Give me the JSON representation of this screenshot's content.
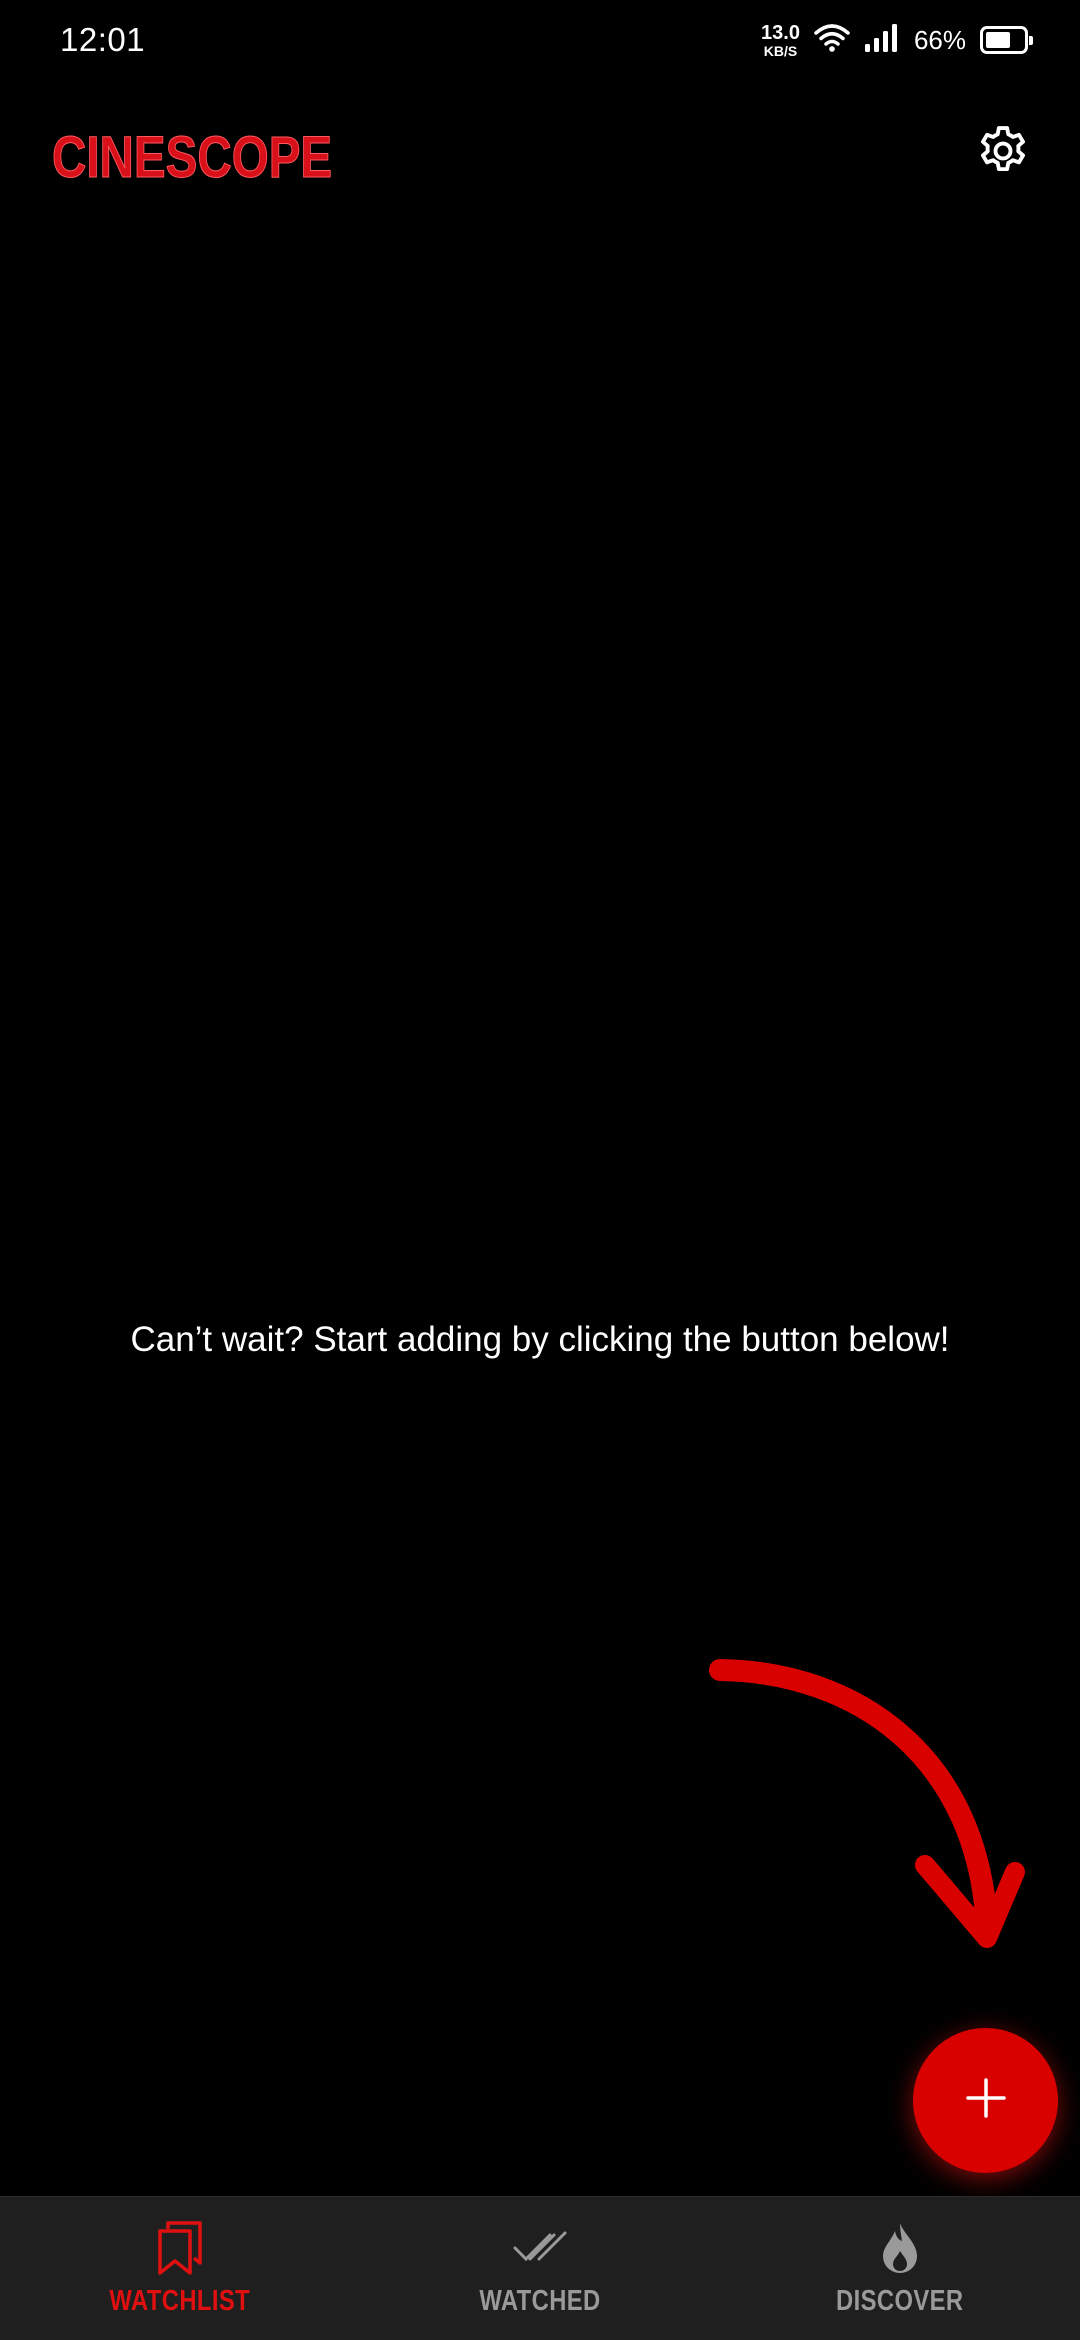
{
  "status_bar": {
    "time": "12:01",
    "net_speed_value": "13.0",
    "net_speed_unit": "KB/S",
    "battery_percent": "66%",
    "battery_level": 0.66
  },
  "header": {
    "logo_text": "CINESCOPE",
    "settings_icon": "gear-icon"
  },
  "main": {
    "empty_message": "Can’t wait? Start adding by clicking the button below!"
  },
  "fab": {
    "icon": "plus-icon"
  },
  "bottom_nav": {
    "items": [
      {
        "label": "WATCHLIST",
        "icon": "bookmarks-icon",
        "active": true
      },
      {
        "label": "WATCHED",
        "icon": "double-check-icon",
        "active": false
      },
      {
        "label": "DISCOVER",
        "icon": "flame-icon",
        "active": false
      }
    ]
  },
  "colors": {
    "accent": "#d90000",
    "background": "#000000",
    "nav_background": "#1f1f1f",
    "inactive": "#9a9a9a"
  }
}
